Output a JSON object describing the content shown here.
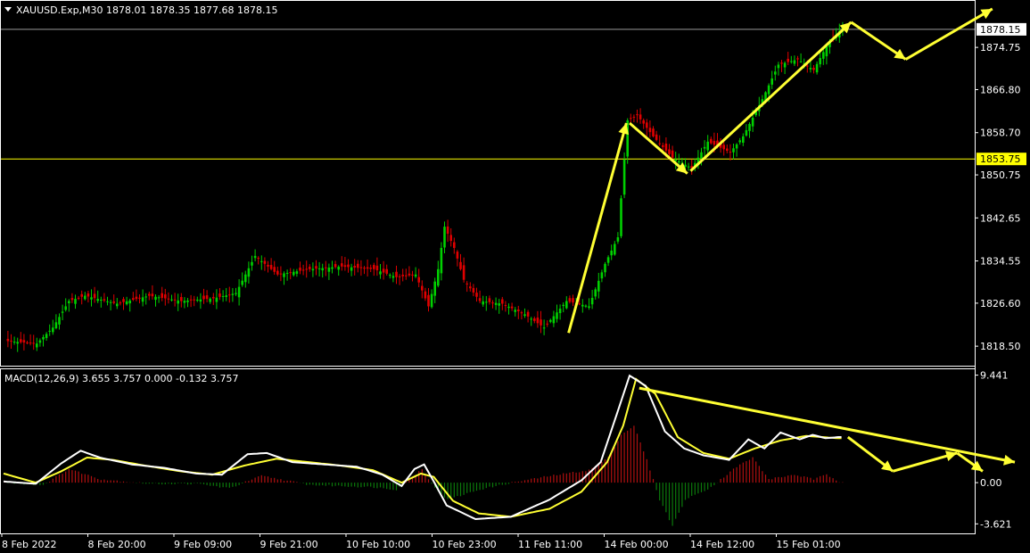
{
  "window": {
    "symbol_header": "XAUUSD.Exp,M30  1878.01 1878.35 1877.68 1878.15",
    "macd_header": "MACD(12,26,9) 3.655 3.757 0.000 -0.132 3.757"
  },
  "colors": {
    "background": "#000000",
    "bull": "#00d000",
    "bear": "#e00000",
    "signal": "#ffff33",
    "macd_line": "#ffffff",
    "hist_pos": "#b01010",
    "hist_neg": "#0b7a0b",
    "grid_border": "#ffffff",
    "price_line_label_bg": "#ffffff",
    "level_line": "#ffff00"
  },
  "chart_data": [
    {
      "type": "candlestick",
      "name": "XAUUSD.Exp,M30",
      "y_ticks": [
        "1874.75",
        "1866.80",
        "1858.70",
        "1850.75",
        "1842.65",
        "1834.55",
        "1826.60",
        "1818.50"
      ],
      "ylim": [
        1815.5,
        1883.0
      ],
      "current_price_label": "1878.15",
      "current_price": 1878.15,
      "horizontal_level_label": "1853.75",
      "horizontal_level": 1853.75,
      "x_labels": [
        "8 Feb 2022",
        "8 Feb 20:00",
        "9 Feb 09:00",
        "9 Feb 21:00",
        "10 Feb 10:00",
        "10 Feb 23:00",
        "11 Feb 11:00",
        "14 Feb 00:00",
        "14 Feb 12:00",
        "15 Feb 01:00"
      ],
      "close_path": [
        [
          0,
          1819.5
        ],
        [
          10,
          1819.0
        ],
        [
          15,
          1822.0
        ],
        [
          20,
          1827.0
        ],
        [
          25,
          1828.0
        ],
        [
          35,
          1826.5
        ],
        [
          45,
          1828.0
        ],
        [
          55,
          1827.0
        ],
        [
          65,
          1827.5
        ],
        [
          72,
          1828.5
        ],
        [
          78,
          1835.5
        ],
        [
          85,
          1832.0
        ],
        [
          95,
          1833.0
        ],
        [
          105,
          1833.5
        ],
        [
          115,
          1833.0
        ],
        [
          122,
          1831.5
        ],
        [
          128,
          1832.0
        ],
        [
          132,
          1826.0
        ],
        [
          135,
          1833.0
        ],
        [
          137,
          1841.0
        ],
        [
          140,
          1837.0
        ],
        [
          143,
          1831.0
        ],
        [
          148,
          1827.0
        ],
        [
          155,
          1826.5
        ],
        [
          162,
          1824.5
        ],
        [
          168,
          1822.0
        ],
        [
          175,
          1827.0
        ],
        [
          182,
          1826.0
        ],
        [
          187,
          1834.0
        ],
        [
          191,
          1839.0
        ],
        [
          194,
          1861.0
        ],
        [
          197,
          1862.0
        ],
        [
          202,
          1858.0
        ],
        [
          208,
          1854.0
        ],
        [
          214,
          1852.0
        ],
        [
          219,
          1857.0
        ],
        [
          226,
          1855.0
        ],
        [
          230,
          1858.0
        ],
        [
          236,
          1865.0
        ],
        [
          241,
          1871.5
        ],
        [
          247,
          1872.5
        ],
        [
          252,
          1870.5
        ],
        [
          256,
          1875.0
        ],
        [
          261,
          1878.5
        ]
      ],
      "annotations": {
        "arrows": [
          [
            [
              176,
              1821.0
            ],
            [
              194,
              1860.5
            ]
          ],
          [
            [
              195,
              1860.5
            ],
            [
              213,
              1851.0
            ]
          ],
          [
            [
              214,
              1851.5
            ],
            [
              264,
              1879.5
            ]
          ],
          [
            [
              264,
              1879.5
            ],
            [
              281,
              1872.5
            ]
          ],
          [
            [
              281,
              1872.5
            ],
            [
              308,
              1882.0
            ]
          ]
        ]
      }
    },
    {
      "type": "macd",
      "name": "MACD(12,26,9)",
      "params": [
        12,
        26,
        9
      ],
      "y_ticks": [
        "9.441",
        "0.00",
        "-3.621"
      ],
      "ylim": [
        -4.3,
        9.8
      ],
      "macd_path": [
        [
          0,
          0.1
        ],
        [
          10,
          -0.1
        ],
        [
          18,
          1.7
        ],
        [
          24,
          2.8
        ],
        [
          30,
          2.2
        ],
        [
          40,
          1.6
        ],
        [
          50,
          1.3
        ],
        [
          60,
          0.8
        ],
        [
          68,
          0.7
        ],
        [
          76,
          2.5
        ],
        [
          82,
          2.6
        ],
        [
          90,
          1.8
        ],
        [
          100,
          1.6
        ],
        [
          110,
          1.4
        ],
        [
          118,
          0.7
        ],
        [
          124,
          -0.3
        ],
        [
          128,
          1.2
        ],
        [
          131,
          1.6
        ],
        [
          134,
          0.1
        ],
        [
          138,
          -2.0
        ],
        [
          147,
          -3.2
        ],
        [
          158,
          -3.0
        ],
        [
          170,
          -1.5
        ],
        [
          180,
          0.2
        ],
        [
          186,
          1.8
        ],
        [
          191,
          6.0
        ],
        [
          195,
          9.4
        ],
        [
          200,
          8.5
        ],
        [
          206,
          4.5
        ],
        [
          212,
          3.0
        ],
        [
          218,
          2.4
        ],
        [
          226,
          2.0
        ],
        [
          232,
          3.8
        ],
        [
          237,
          3.0
        ],
        [
          242,
          4.4
        ],
        [
          248,
          3.8
        ],
        [
          252,
          4.2
        ],
        [
          256,
          3.9
        ],
        [
          260,
          4.0
        ]
      ],
      "signal_path": [
        [
          0,
          0.8
        ],
        [
          10,
          0.0
        ],
        [
          18,
          1.0
        ],
        [
          26,
          2.2
        ],
        [
          34,
          2.0
        ],
        [
          44,
          1.5
        ],
        [
          55,
          1.0
        ],
        [
          65,
          0.7
        ],
        [
          75,
          1.5
        ],
        [
          85,
          2.1
        ],
        [
          95,
          1.8
        ],
        [
          105,
          1.5
        ],
        [
          115,
          1.1
        ],
        [
          124,
          0.0
        ],
        [
          130,
          0.8
        ],
        [
          134,
          0.5
        ],
        [
          140,
          -1.6
        ],
        [
          148,
          -2.7
        ],
        [
          158,
          -3.0
        ],
        [
          170,
          -2.3
        ],
        [
          180,
          -0.8
        ],
        [
          188,
          1.8
        ],
        [
          193,
          5.0
        ],
        [
          197,
          9.1
        ],
        [
          203,
          7.8
        ],
        [
          210,
          4.0
        ],
        [
          218,
          2.6
        ],
        [
          226,
          2.1
        ],
        [
          234,
          3.0
        ],
        [
          242,
          3.7
        ],
        [
          250,
          4.1
        ],
        [
          260,
          3.9
        ]
      ],
      "histogram_path": [
        [
          0,
          0.0
        ],
        [
          12,
          -0.2
        ],
        [
          20,
          1.2
        ],
        [
          30,
          0.3
        ],
        [
          45,
          -0.1
        ],
        [
          60,
          -0.1
        ],
        [
          70,
          -0.5
        ],
        [
          80,
          0.6
        ],
        [
          95,
          -0.2
        ],
        [
          115,
          -0.4
        ],
        [
          122,
          -0.6
        ],
        [
          130,
          1.2
        ],
        [
          134,
          -0.5
        ],
        [
          138,
          -1.5
        ],
        [
          148,
          -0.6
        ],
        [
          158,
          0.0
        ],
        [
          170,
          0.6
        ],
        [
          182,
          1.1
        ],
        [
          188,
          2.2
        ],
        [
          192,
          4.2
        ],
        [
          196,
          5.0
        ],
        [
          200,
          2.0
        ],
        [
          204,
          -1.5
        ],
        [
          208,
          -3.8
        ],
        [
          212,
          -1.5
        ],
        [
          220,
          -0.4
        ],
        [
          228,
          1.4
        ],
        [
          233,
          2.2
        ],
        [
          238,
          0.3
        ],
        [
          246,
          0.7
        ],
        [
          252,
          0.3
        ],
        [
          256,
          0.7
        ],
        [
          260,
          0.1
        ]
      ],
      "annotations": {
        "trendline": [
          [
            198,
            8.3
          ],
          [
            315,
            1.8
          ]
        ],
        "arrows": [
          [
            [
              263,
              4.0
            ],
            [
              277,
              1.0
            ]
          ],
          [
            [
              277,
              1.0
            ],
            [
              297,
              2.6
            ]
          ],
          [
            [
              297,
              2.6
            ],
            [
              305,
              1.0
            ]
          ]
        ]
      }
    }
  ]
}
